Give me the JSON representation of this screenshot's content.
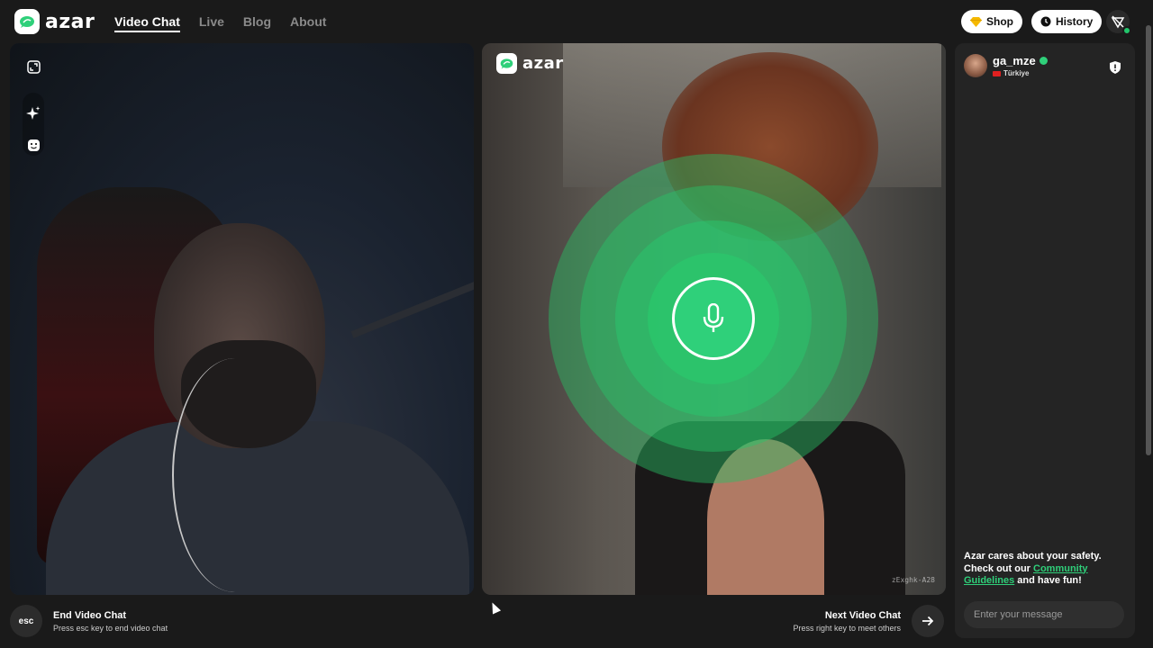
{
  "brand": {
    "name": "azar",
    "logo_icon": "azar-logo-icon"
  },
  "nav": {
    "items": [
      {
        "label": "Video Chat",
        "active": true
      },
      {
        "label": "Live",
        "active": false
      },
      {
        "label": "Blog",
        "active": false
      },
      {
        "label": "About",
        "active": false
      }
    ]
  },
  "header": {
    "shop_label": "Shop",
    "history_label": "History"
  },
  "left_video": {
    "tools": [
      "fullscreen-icon",
      "sparkle-effects-icon",
      "face-mask-icon"
    ]
  },
  "right_video": {
    "watermark": "azar",
    "session_id": "zExghk-A28",
    "state_icon": "microphone-icon"
  },
  "chat": {
    "partner": {
      "username": "ga_mze",
      "country": "Türkiye",
      "verified": true
    },
    "safety": {
      "line1": "Azar cares about your safety.",
      "line2_prefix": "Check out our ",
      "link_text": "Community Guidelines",
      "line2_suffix": " and have fun!"
    },
    "input_placeholder": "Enter your message"
  },
  "footer": {
    "end": {
      "key": "esc",
      "title": "End Video Chat",
      "subtitle": "Press esc key to end video chat"
    },
    "next": {
      "title": "Next Video Chat",
      "subtitle": "Press right key to meet others"
    }
  },
  "colors": {
    "background": "#1a1a1a",
    "accent_green": "#2fd07a",
    "panel": "#242424"
  }
}
